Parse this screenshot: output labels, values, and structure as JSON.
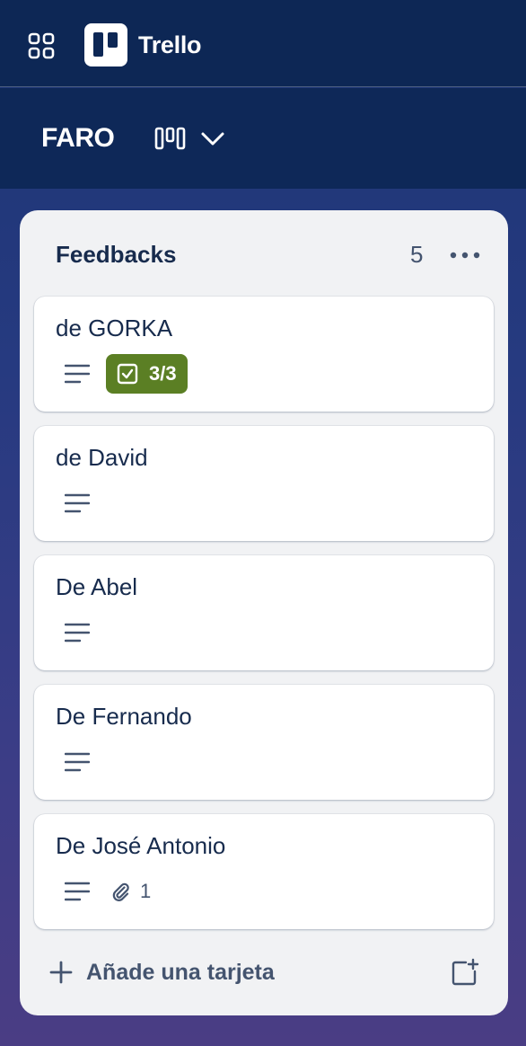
{
  "app": {
    "name": "Trello"
  },
  "board": {
    "name": "FARO"
  },
  "list": {
    "title": "Feedbacks",
    "count": "5",
    "add_card_label": "Añade una tarjeta"
  },
  "cards": [
    {
      "title": "de GORKA",
      "has_description": true,
      "checklist": "3/3",
      "checklist_color": "#5b7f24"
    },
    {
      "title": "de David",
      "has_description": true
    },
    {
      "title": "De Abel",
      "has_description": true
    },
    {
      "title": "De Fernando",
      "has_description": true
    },
    {
      "title": "De José Antonio",
      "has_description": true,
      "attachments": "1"
    }
  ],
  "colors": {
    "topbar": "#0d2755",
    "list_bg": "#f1f2f4",
    "text": "#172b4d",
    "subtle_text": "#44546f"
  },
  "icons": {
    "apps": "apps-grid-icon",
    "logo": "trello-logo-icon",
    "board_view": "board-columns-icon",
    "chevron": "chevron-down-icon",
    "list_menu": "more-horizontal-icon",
    "description": "description-lines-icon",
    "checklist": "checkbox-icon",
    "attachment": "paperclip-icon",
    "plus": "plus-icon",
    "template": "card-template-icon"
  }
}
